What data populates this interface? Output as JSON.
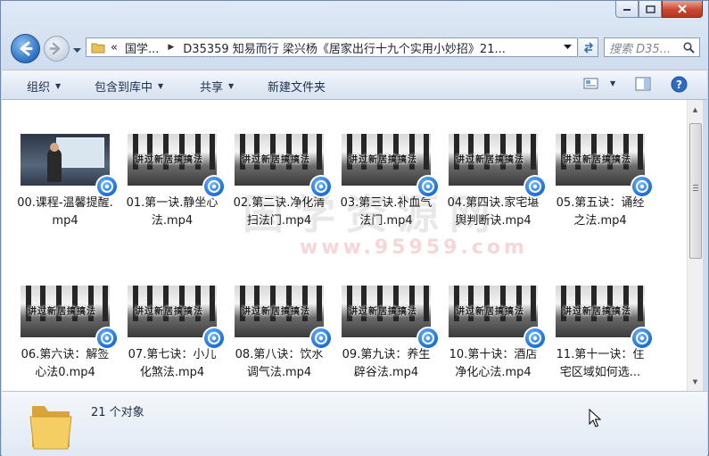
{
  "address": {
    "crumbs": [
      "«",
      "国学...",
      "D35359 知易而行 梁兴杨《居家出行十九个实用小妙招》21..."
    ]
  },
  "search": {
    "placeholder": "搜索 D35..."
  },
  "toolbar": {
    "organize": "组织",
    "include_library": "包含到库中",
    "share": "共享",
    "new_folder": "新建文件夹"
  },
  "watermark": {
    "line1": "国学资源网",
    "line2": "www.95959.com"
  },
  "thumbnail_caption": "讲过新居搞搞法",
  "files": [
    {
      "name": "00.课程-温馨提醒.mp4",
      "kind": "studio"
    },
    {
      "name": "01.第一诀.静坐心法.mp4",
      "kind": "lesson"
    },
    {
      "name": "02.第二诀.净化清扫法门.mp4",
      "kind": "lesson"
    },
    {
      "name": "03.第三诀.补血气法门.mp4",
      "kind": "lesson"
    },
    {
      "name": "04.第四诀.家宅堪舆判断诀.mp4",
      "kind": "lesson"
    },
    {
      "name": "05.第五诀：诵经之法.mp4",
      "kind": "lesson"
    },
    {
      "name": "06.第六诀：解签心法0.mp4",
      "kind": "lesson"
    },
    {
      "name": "07.第七诀：小儿化煞法.mp4",
      "kind": "lesson"
    },
    {
      "name": "08.第八诀：饮水调气法.mp4",
      "kind": "lesson"
    },
    {
      "name": "09.第九诀：养生辟谷法.mp4",
      "kind": "lesson"
    },
    {
      "name": "10.第十诀：酒店净化心法.mp4",
      "kind": "lesson"
    },
    {
      "name": "11.第十一诀：住宅区域如何选..."
    }
  ],
  "file_lines": [
    [
      "00.课程-温馨提醒.",
      "mp4"
    ],
    [
      "01.第一诀.静坐心",
      "法.mp4"
    ],
    [
      "02.第二诀.净化清",
      "扫法门.mp4"
    ],
    [
      "03.第三诀.补血气",
      "法门.mp4"
    ],
    [
      "04.第四诀.家宅堪",
      "舆判断诀.mp4"
    ],
    [
      "05.第五诀：诵经",
      "之法.mp4"
    ],
    [
      "06.第六诀：解签",
      "心法0.mp4"
    ],
    [
      "07.第七诀：小儿",
      "化煞法.mp4"
    ],
    [
      "08.第八诀：饮水",
      "调气法.mp4"
    ],
    [
      "09.第九诀：养生",
      "辟谷法.mp4"
    ],
    [
      "10.第十诀：酒店",
      "净化心法.mp4"
    ],
    [
      "11.第十一诀：住",
      "宅区域如何选..."
    ]
  ],
  "details": {
    "count": "21 个对象"
  }
}
